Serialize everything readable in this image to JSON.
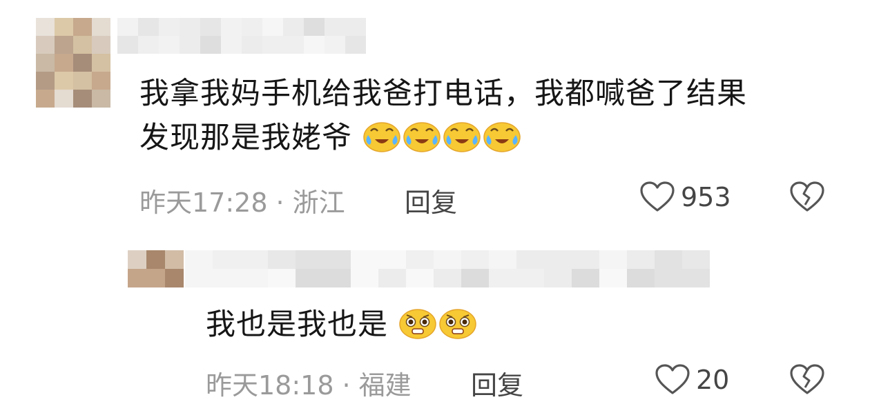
{
  "comments": [
    {
      "text": "我拿我妈手机给我爸打电话，我都喊爸了结果",
      "text_line2": "发现那是我姥爷",
      "emojis": [
        "crying-laughing-emoji",
        "crying-laughing-emoji",
        "crying-laughing-emoji",
        "crying-laughing-emoji"
      ],
      "time": "昨天17:28",
      "separator": "·",
      "location": "浙江",
      "reply_label": "回复",
      "likes": "953"
    },
    {
      "text": "我也是我也是",
      "emojis": [
        "pleading-emoji",
        "pleading-emoji"
      ],
      "time": "昨天18:18",
      "separator": "·",
      "location": "福建",
      "reply_label": "回复",
      "likes": "20"
    }
  ],
  "colors": {
    "text": "#161616",
    "meta": "#9a9a9a",
    "action": "#454545",
    "icon": "#555555",
    "emoji_face": "#f7c934"
  }
}
